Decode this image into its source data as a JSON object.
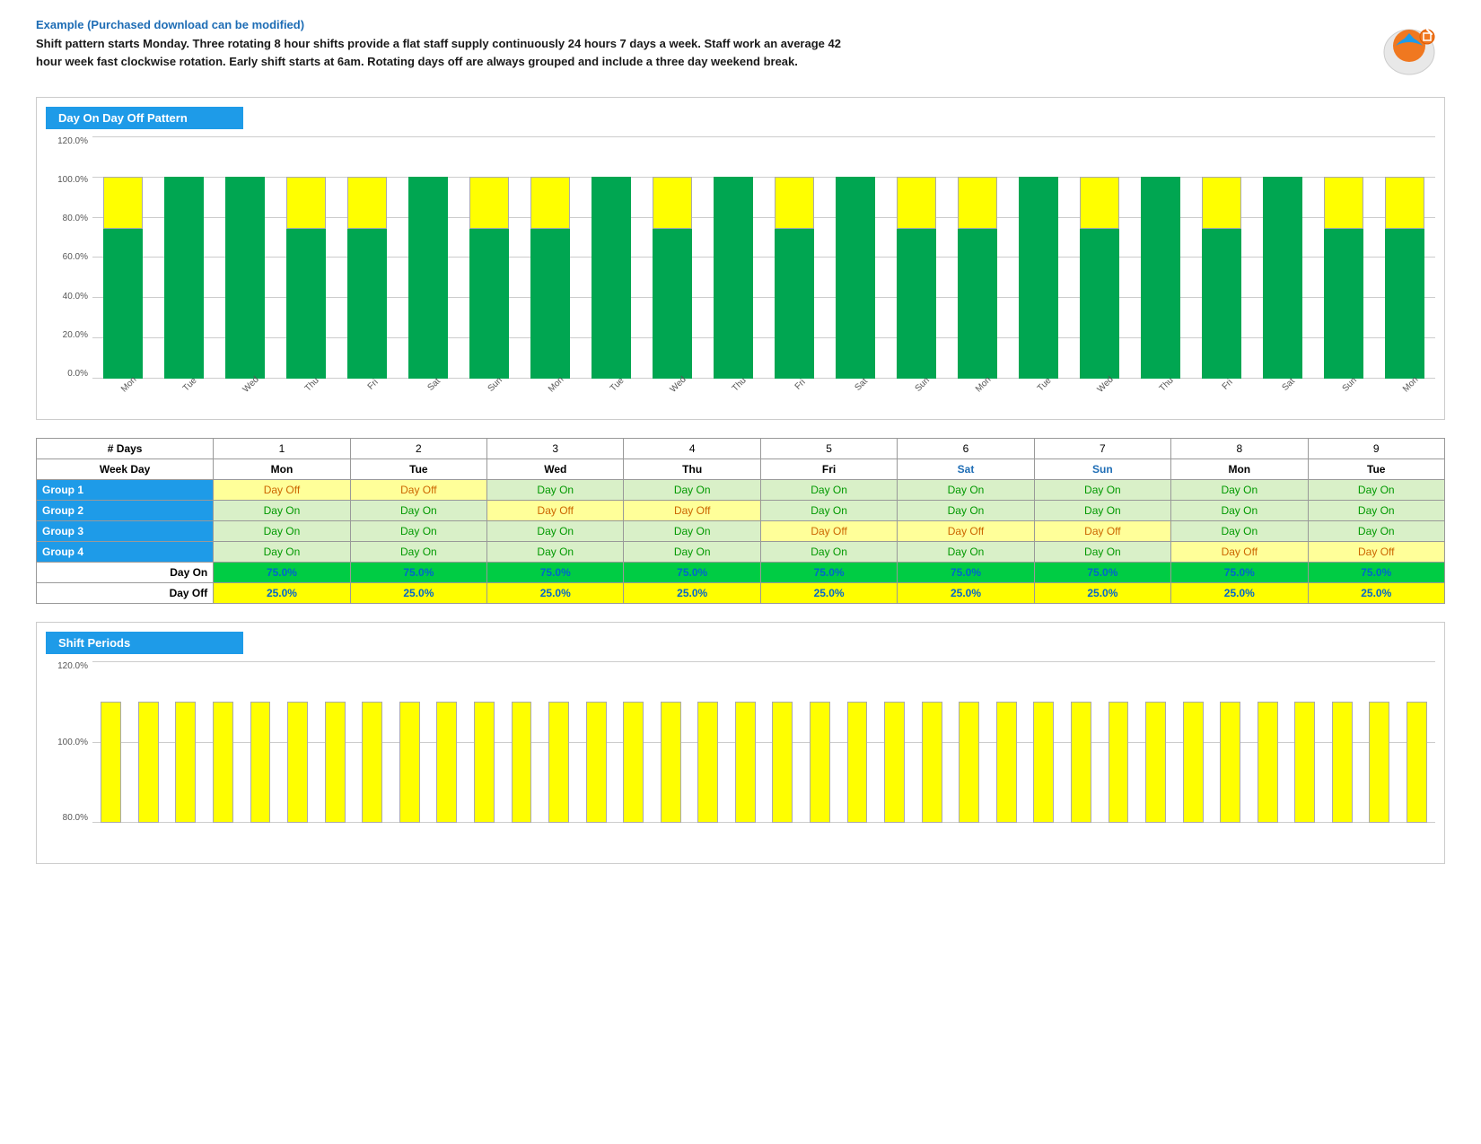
{
  "header": {
    "example_label": "Example (Purchased download can be modified)",
    "description": "Shift pattern starts Monday. Three rotating 8 hour  shifts provide a flat staff supply continuously 24 hours 7 days a week. Staff work an average 42 hour week fast clockwise rotation. Early shift starts at 6am. Rotating days off are always grouped  and include a three day weekend break."
  },
  "chart1": {
    "title": "Day On Day Off Pattern",
    "y_labels": [
      "0.0%",
      "20.0%",
      "40.0%",
      "60.0%",
      "80.0%",
      "100.0%",
      "120.0%"
    ],
    "bars": [
      {
        "day": "Mon",
        "green": 75,
        "yellow": 25
      },
      {
        "day": "Tue",
        "green": 100,
        "yellow": 0
      },
      {
        "day": "Wed",
        "green": 100,
        "yellow": 0
      },
      {
        "day": "Thu",
        "green": 75,
        "yellow": 25
      },
      {
        "day": "Fri",
        "green": 75,
        "yellow": 25
      },
      {
        "day": "Sat",
        "green": 100,
        "yellow": 0
      },
      {
        "day": "Sun",
        "green": 75,
        "yellow": 25
      },
      {
        "day": "Mon",
        "green": 75,
        "yellow": 25
      },
      {
        "day": "Tue",
        "green": 100,
        "yellow": 0
      },
      {
        "day": "Wed",
        "green": 75,
        "yellow": 25
      },
      {
        "day": "Thu",
        "green": 100,
        "yellow": 0
      },
      {
        "day": "Fri",
        "green": 75,
        "yellow": 25
      },
      {
        "day": "Sat",
        "green": 100,
        "yellow": 0
      },
      {
        "day": "Sun",
        "green": 75,
        "yellow": 25
      },
      {
        "day": "Mon",
        "green": 75,
        "yellow": 25
      },
      {
        "day": "Tue",
        "green": 100,
        "yellow": 0
      },
      {
        "day": "Wed",
        "green": 75,
        "yellow": 25
      },
      {
        "day": "Thu",
        "green": 100,
        "yellow": 0
      },
      {
        "day": "Fri",
        "green": 75,
        "yellow": 25
      },
      {
        "day": "Sat",
        "green": 100,
        "yellow": 0
      },
      {
        "day": "Sun",
        "green": 75,
        "yellow": 25
      },
      {
        "day": "Mon",
        "green": 75,
        "yellow": 25
      }
    ]
  },
  "table": {
    "days_row_label": "# Days",
    "weekday_row_label": "Week Day",
    "days": [
      "1",
      "2",
      "3",
      "4",
      "5",
      "6",
      "7",
      "8",
      "9"
    ],
    "weekdays": [
      "Mon",
      "Tue",
      "Wed",
      "Thu",
      "Fri",
      "Sat",
      "Sun",
      "Mon",
      "Tue"
    ],
    "weekend": [
      false,
      false,
      false,
      false,
      false,
      true,
      true,
      false,
      false
    ],
    "groups": [
      {
        "label": "Group 1",
        "cells": [
          "Day Off",
          "Day Off",
          "Day On",
          "Day On",
          "Day On",
          "Day On",
          "Day On",
          "Day On",
          "Day On"
        ]
      },
      {
        "label": "Group 2",
        "cells": [
          "Day On",
          "Day On",
          "Day Off",
          "Day Off",
          "Day On",
          "Day On",
          "Day On",
          "Day On",
          "Day On"
        ]
      },
      {
        "label": "Group 3",
        "cells": [
          "Day On",
          "Day On",
          "Day On",
          "Day On",
          "Day Off",
          "Day Off",
          "Day Off",
          "Day On",
          "Day On"
        ]
      },
      {
        "label": "Group 4",
        "cells": [
          "Day On",
          "Day On",
          "Day On",
          "Day On",
          "Day On",
          "Day On",
          "Day On",
          "Day Off",
          "Day Off"
        ]
      }
    ],
    "day_on_label": "Day On",
    "day_off_label": "Day Off",
    "day_on_pct": [
      "75.0%",
      "75.0%",
      "75.0%",
      "75.0%",
      "75.0%",
      "75.0%",
      "75.0%",
      "75.0%",
      "75.0%"
    ],
    "day_off_pct": [
      "25.0%",
      "25.0%",
      "25.0%",
      "25.0%",
      "25.0%",
      "25.0%",
      "25.0%",
      "25.0%",
      "25.0%"
    ]
  },
  "chart2": {
    "title": "Shift Periods",
    "y_labels": [
      "80.0%",
      "100.0%",
      "120.0%"
    ]
  }
}
